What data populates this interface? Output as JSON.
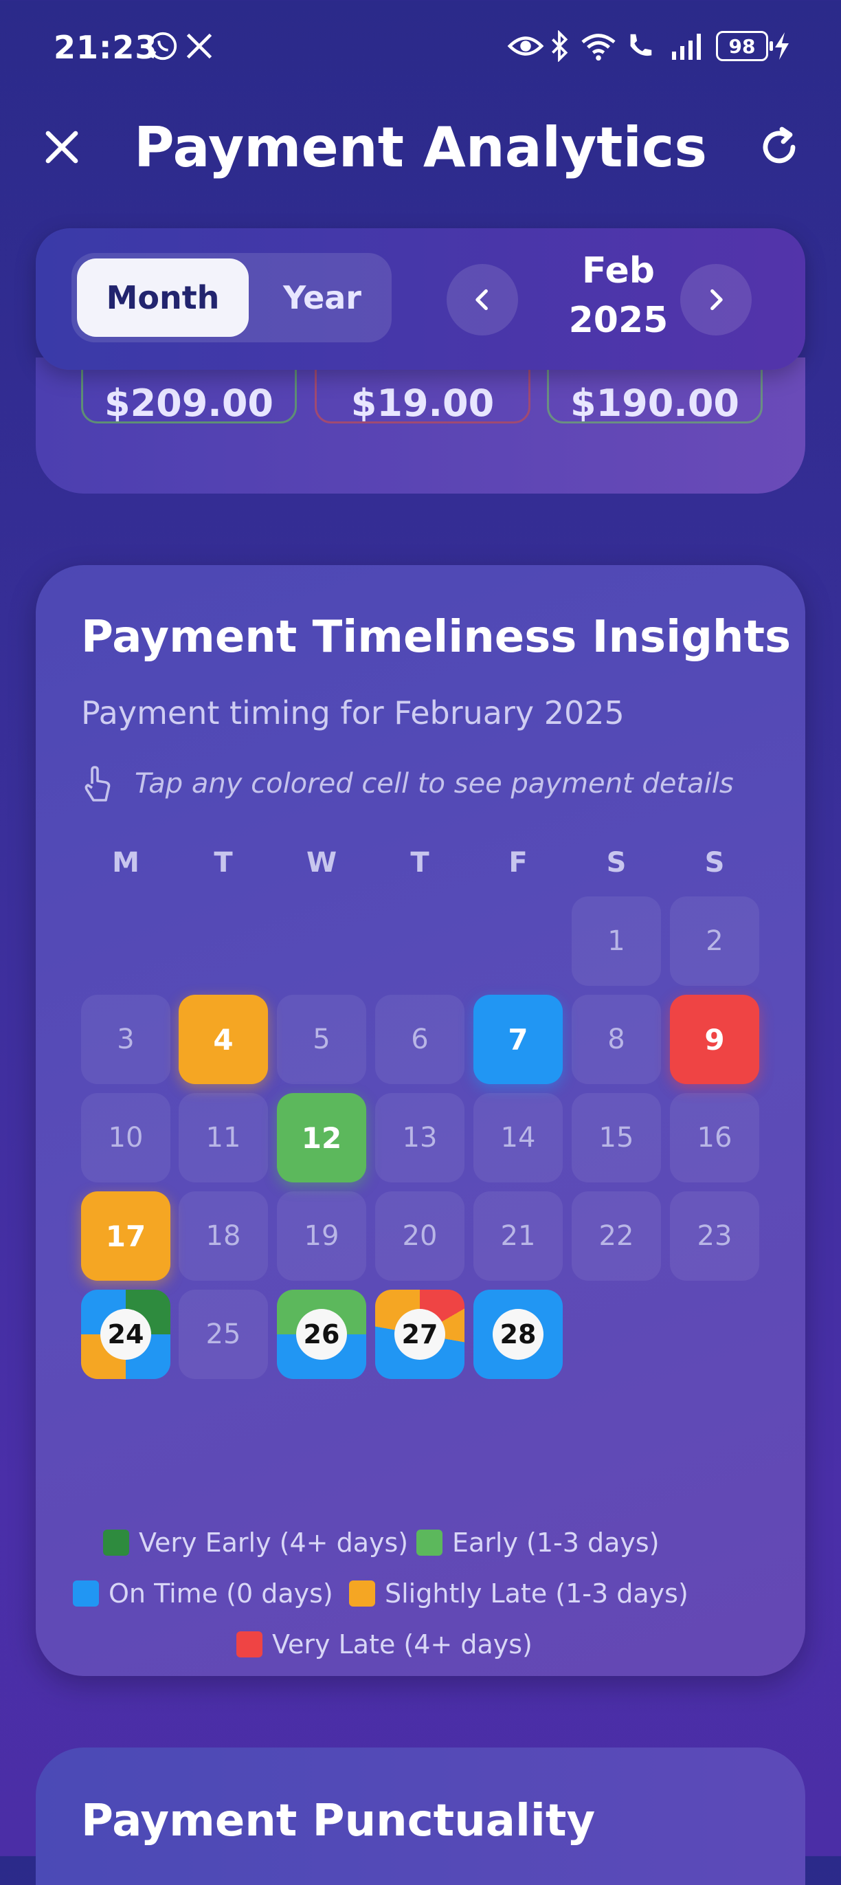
{
  "status_bar": {
    "time": "21:23",
    "battery": "98"
  },
  "header": {
    "title": "Payment Analytics"
  },
  "controls": {
    "month_label": "Month",
    "year_label": "Year",
    "period_month": "Feb",
    "period_year": "2025"
  },
  "stats": {
    "values": [
      "$209.00",
      "$19.00",
      "$190.00"
    ],
    "colors": [
      "#5a8a6a",
      "#9a4a6a",
      "#6a8a7a"
    ]
  },
  "insights": {
    "title": "Payment Timeliness Insights",
    "subtitle": "Payment timing for February 2025",
    "hint": "Tap any colored cell to see payment details",
    "weekdays": [
      "M",
      "T",
      "W",
      "T",
      "F",
      "S",
      "S"
    ],
    "days": [
      "1",
      "2",
      "3",
      "4",
      "5",
      "6",
      "7",
      "8",
      "9",
      "10",
      "11",
      "12",
      "13",
      "14",
      "15",
      "16",
      "17",
      "18",
      "19",
      "20",
      "21",
      "22",
      "23",
      "24",
      "25",
      "26",
      "27",
      "28"
    ]
  },
  "legend": {
    "very_early": "Very Early (4+ days)",
    "early": "Early (1-3 days)",
    "on_time": "On Time (0 days)",
    "slightly_late": "Slightly Late (1-3 days)",
    "very_late": "Very Late (4+ days)"
  },
  "colors": {
    "very_early": "#2e8b3e",
    "early": "#5cb85c",
    "on_time": "#2196f3",
    "slightly_late": "#f5a623",
    "very_late": "#ef4444"
  },
  "punctuality": {
    "title": "Payment Punctuality"
  }
}
